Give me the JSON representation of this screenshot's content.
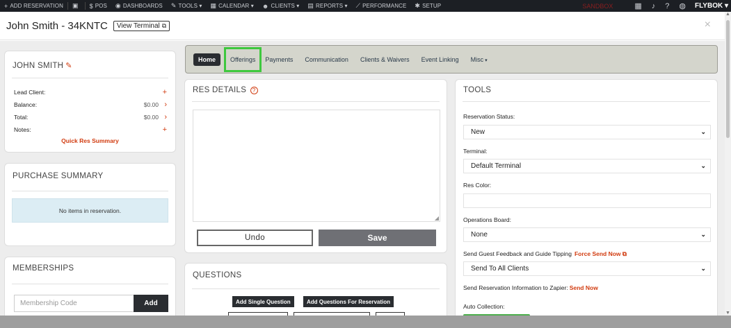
{
  "topnav": {
    "items": [
      {
        "icon": "plus-icon",
        "glyph": "+",
        "label": "ADD RESERVATION"
      },
      {
        "icon": "calculator-icon",
        "glyph": "▣",
        "label": ""
      },
      {
        "icon": "dollar-icon",
        "glyph": "$",
        "label": "POS"
      },
      {
        "icon": "dashboard-icon",
        "glyph": "◉",
        "label": "DASHBOARDS"
      },
      {
        "icon": "wrench-icon",
        "glyph": "✎",
        "label": "TOOLS ▾"
      },
      {
        "icon": "calendar-icon",
        "glyph": "▦",
        "label": "CALENDAR ▾"
      },
      {
        "icon": "users-icon",
        "glyph": "☻",
        "label": "CLIENTS ▾"
      },
      {
        "icon": "report-icon",
        "glyph": "▤",
        "label": "REPORTS ▾"
      },
      {
        "icon": "chart-icon",
        "glyph": "⟋",
        "label": "PERFORMANCE"
      },
      {
        "icon": "gear-icon",
        "glyph": "✱",
        "label": "SETUP"
      }
    ],
    "sandbox_label": "SANDBOX",
    "brand": "FLYBOK ▾"
  },
  "modal": {
    "title": "John Smith - 34KNTC",
    "view_terminal": "View Terminal",
    "close": "×"
  },
  "client": {
    "name": "JOHN SMITH",
    "rows": [
      {
        "label": "Lead Client:",
        "value": "",
        "action": "+"
      },
      {
        "label": "Balance:",
        "value": "$0.00",
        "action": "›"
      },
      {
        "label": "Total:",
        "value": "$0.00",
        "action": "›"
      },
      {
        "label": "Notes:",
        "value": "",
        "action": "+"
      }
    ],
    "quick_res": "Quick Res Summary"
  },
  "purchase": {
    "title": "PURCHASE SUMMARY",
    "empty": "No items in reservation."
  },
  "memberships": {
    "title": "MEMBERSHIPS",
    "placeholder": "Membership Code",
    "add": "Add"
  },
  "tabs": [
    {
      "label": "Home",
      "state": "active"
    },
    {
      "label": "Offerings",
      "state": "highlight"
    },
    {
      "label": "Payments",
      "state": ""
    },
    {
      "label": "Communication",
      "state": ""
    },
    {
      "label": "Clients & Waivers",
      "state": ""
    },
    {
      "label": "Event Linking",
      "state": ""
    },
    {
      "label": "Misc",
      "state": "dropdown"
    }
  ],
  "res_details": {
    "title": "RES DETAILS",
    "undo": "Undo",
    "save": "Save"
  },
  "questions": {
    "title": "QUESTIONS",
    "add_single": "Add Single Question",
    "add_for_res": "Add Questions For Reservation"
  },
  "tools": {
    "title": "TOOLS",
    "reservation_status_label": "Reservation Status:",
    "reservation_status_value": "New",
    "terminal_label": "Terminal:",
    "terminal_value": "Default Terminal",
    "res_color_label": "Res Color:",
    "ops_board_label": "Operations Board:",
    "ops_board_value": "None",
    "feedback_label": "Send Guest Feedback and Guide Tipping",
    "force_send": "Force Send Now",
    "feedback_value": "Send To All Clients",
    "zapier_label": "Send Reservation Information to Zapier:",
    "send_now": "Send Now",
    "auto_collection_label": "Auto Collection:"
  },
  "colors": {
    "accent": "#d13b0f",
    "highlight": "#3ec83e",
    "dark": "#2a2d31",
    "nav_bg": "#1c1f24"
  }
}
